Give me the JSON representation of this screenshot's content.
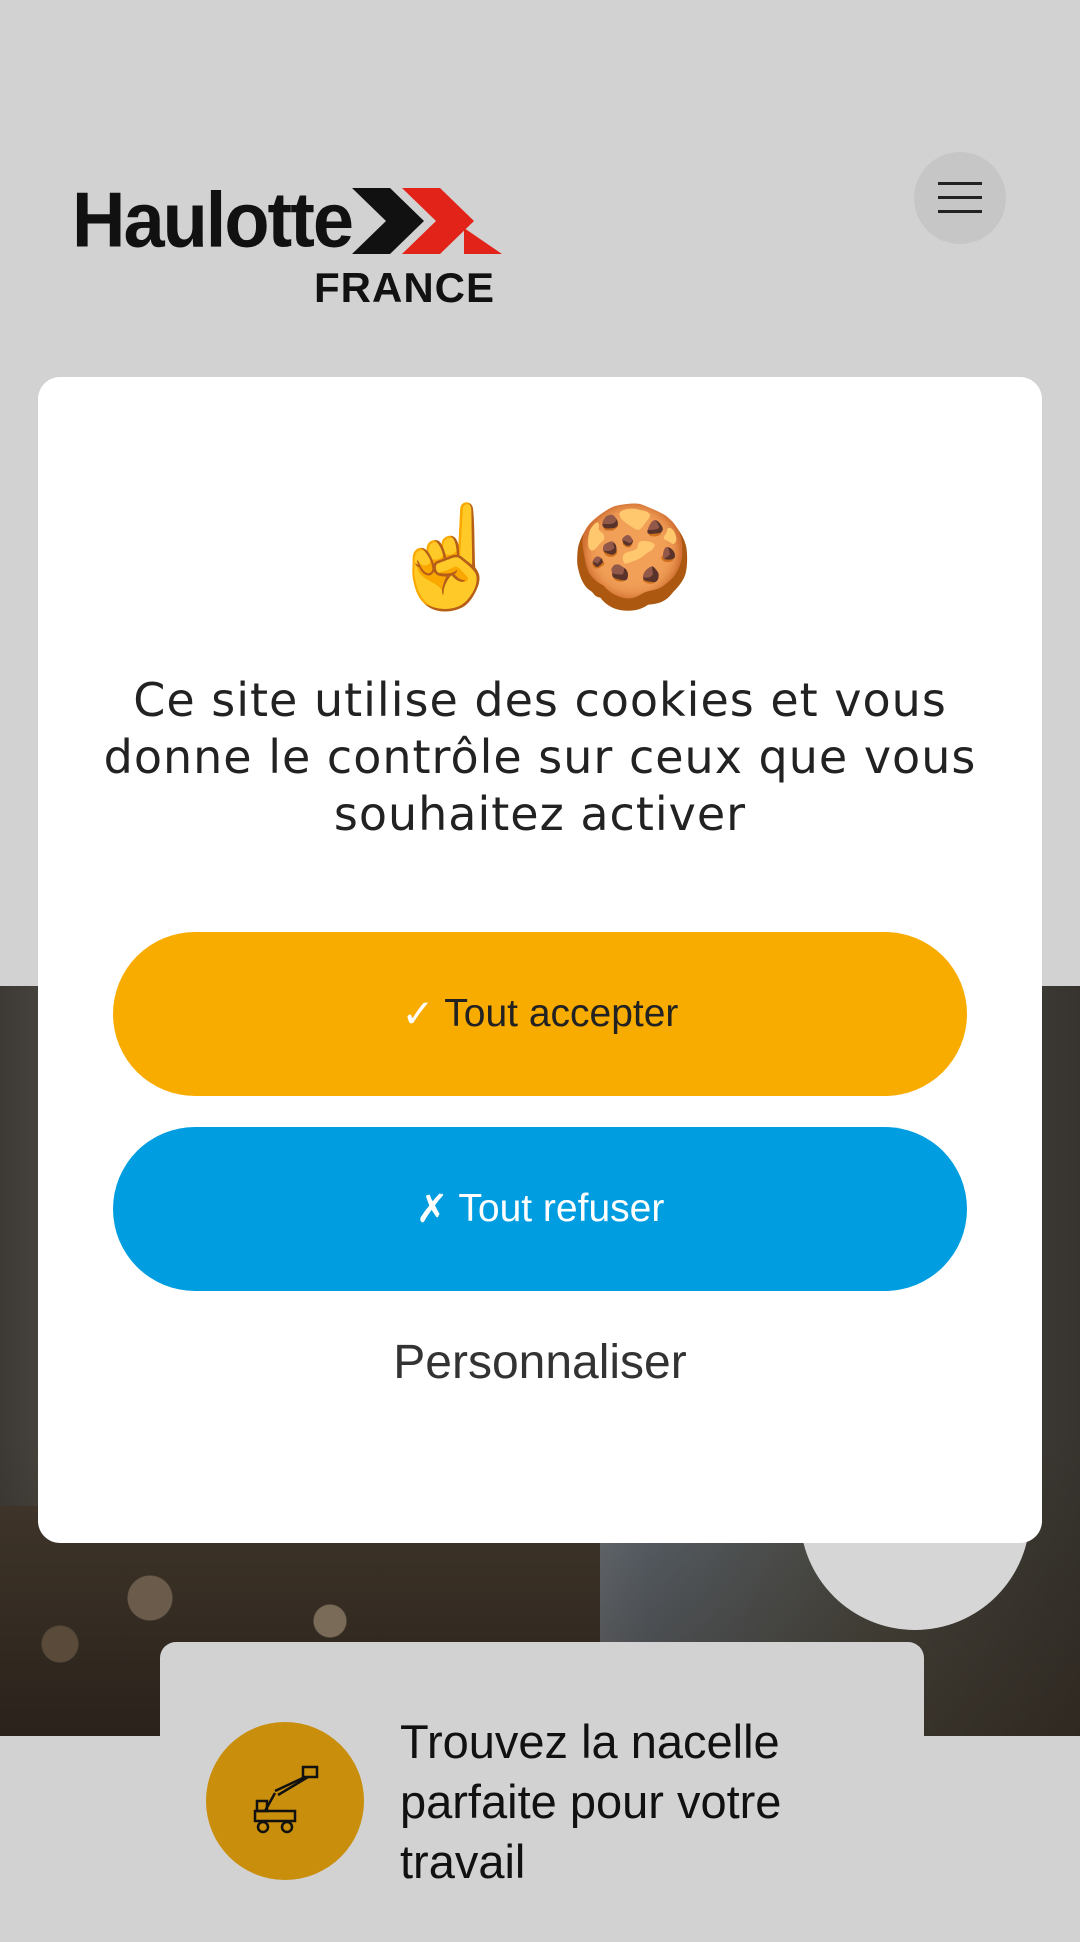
{
  "header": {
    "logo_text": "Haulotte",
    "logo_country": "FRANCE",
    "menu_icon": "hamburger-icon"
  },
  "cookie_modal": {
    "emojis": [
      "☝️",
      "🍪"
    ],
    "message": "Ce site utilise des cookies et vous donne le contrôle sur ceux que vous souhaitez activer",
    "accept": {
      "mark": "✓",
      "label": "Tout accepter"
    },
    "refuse": {
      "mark": "✗",
      "label": "Tout refuser"
    },
    "personalize_label": "Personnaliser"
  },
  "promo": {
    "icon": "aerial-lift-icon",
    "text": "Trouvez la nacelle parfaite pour votre travail"
  },
  "colors": {
    "accept": "#f8ac00",
    "refuse": "#009ee0",
    "promo_icon_bg": "#c98e0b",
    "brand_red": "#e2231a"
  }
}
